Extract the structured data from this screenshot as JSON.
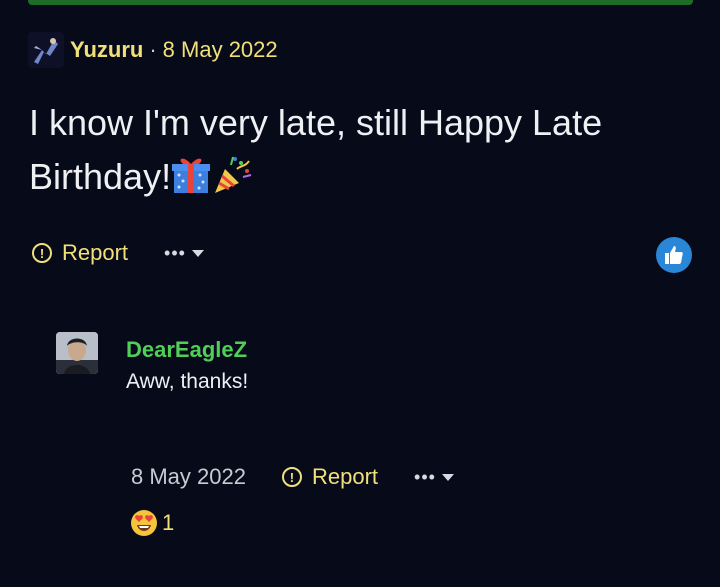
{
  "post": {
    "author": "Yuzuru",
    "separator": "·",
    "date": "8 May 2022",
    "body": "I know I'm very late, still Happy Late Birthday!",
    "emojis": [
      "gift-emoji",
      "party-popper-emoji"
    ],
    "report_label": "Report",
    "more_label": "•••",
    "liked": true
  },
  "reply": {
    "author": "DearEagleZ",
    "text": "Aww, thanks!",
    "date": "8 May 2022",
    "report_label": "Report",
    "more_label": "•••",
    "reaction": {
      "icon": "heart-eyes-emoji",
      "count": "1"
    }
  },
  "colors": {
    "background": "#070a18",
    "accent_yellow": "#f1e07a",
    "author_green": "#4fcf57",
    "like_blue": "#2a87d8",
    "top_bar_green": "#1f6b2a"
  }
}
